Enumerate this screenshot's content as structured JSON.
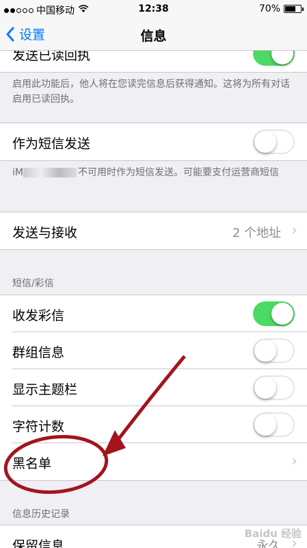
{
  "status_bar": {
    "carrier": "中国移动",
    "time": "12:38",
    "battery": "70%",
    "battery_level": 0.7
  },
  "nav": {
    "back_label": "设置",
    "title": "信息"
  },
  "read_receipts": {
    "label": "发送已读回执",
    "on": true,
    "footer": "启用此功能后，他人将在您读完信息后获得通知。这将为所有对话启用已读回执。"
  },
  "send_as_sms": {
    "label": "作为短信发送",
    "on": false,
    "footer_prefix": "iM",
    "footer": "不可用时作为短信发送。可能要支付运营商短信"
  },
  "send_receive": {
    "label": "发送与接收",
    "value": "2 个地址"
  },
  "sms_mms": {
    "header": "短信/彩信",
    "items": [
      {
        "label": "收发彩信",
        "on": true
      },
      {
        "label": "群组信息",
        "on": false
      },
      {
        "label": "显示主题栏",
        "on": false
      },
      {
        "label": "字符计数",
        "on": false
      },
      {
        "label": "黑名单"
      }
    ]
  },
  "history": {
    "header": "信息历史记录",
    "keep_label": "保留信息",
    "keep_value": "永久"
  },
  "colors": {
    "accent": "#007aff",
    "toggle_on": "#4cd964",
    "annotation": "#a3141c"
  },
  "watermark": "Baidu 经验"
}
